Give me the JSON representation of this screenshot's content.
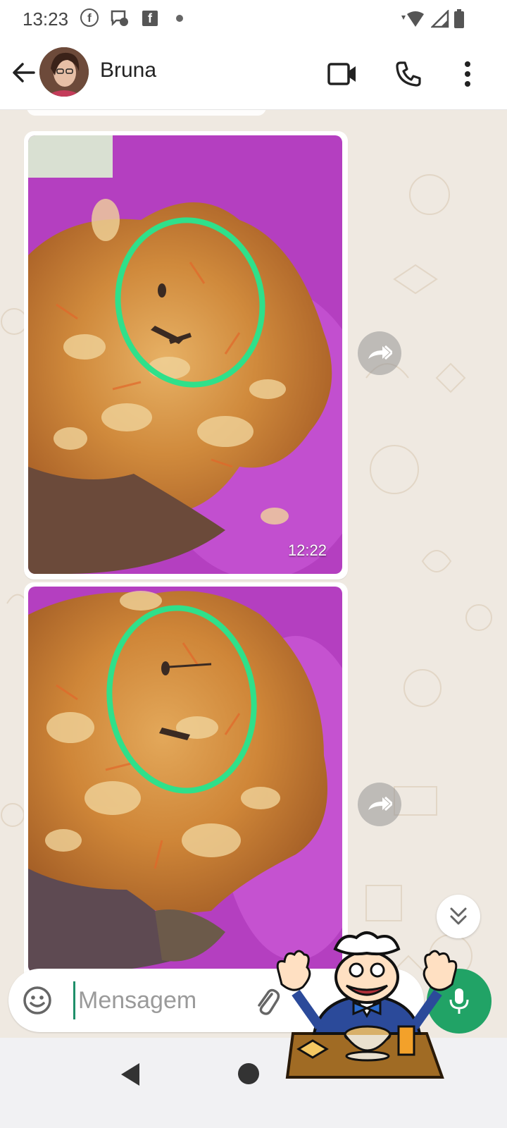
{
  "status_bar": {
    "time": "13:23",
    "icons": [
      "facebook-icon",
      "messenger-icon",
      "facebook-square-icon",
      "dot-icon",
      "wifi-icon",
      "signal-icon",
      "battery-icon"
    ]
  },
  "app_bar": {
    "contact_name": "Bruna",
    "icons": [
      "back-arrow-icon",
      "video-call-icon",
      "phone-icon",
      "more-vert-icon"
    ]
  },
  "messages": [
    {
      "type": "image",
      "time": "12:22",
      "description_icon": "photo"
    },
    {
      "type": "image",
      "time": ""
    }
  ],
  "input": {
    "placeholder": "Mensagem"
  },
  "colors": {
    "accent_green": "#21a366",
    "chat_bg": "#efe9e1",
    "circle_highlight": "#2fe08a"
  }
}
